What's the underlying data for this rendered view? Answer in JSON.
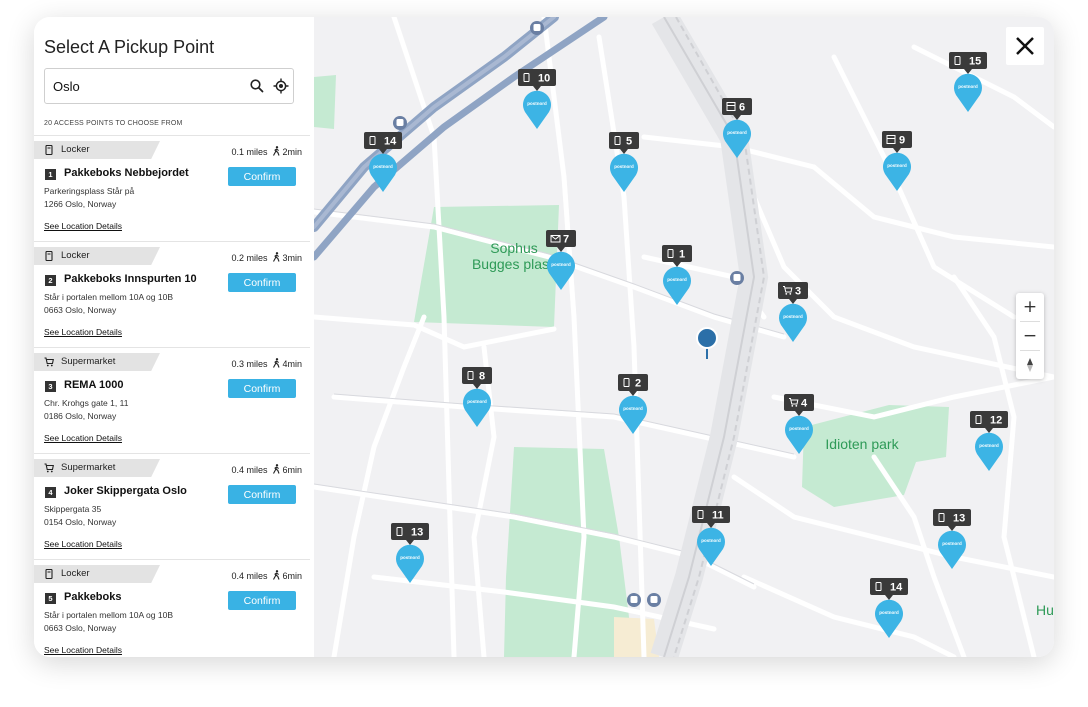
{
  "panel": {
    "title": "Select A Pickup Point",
    "search_value": "Oslo",
    "count_text": "20 ACCESS POINTS TO CHOOSE FROM"
  },
  "items": [
    {
      "category": "Locker",
      "icon": "locker-icon",
      "distance": "0.1 miles",
      "walk": "2min",
      "number": "1",
      "name": "Pakkeboks Nebbejordet",
      "address1": "Parkeringsplass Står på",
      "address2": "1266 Oslo, Norway",
      "confirm": "Confirm",
      "details": "See Location Details"
    },
    {
      "category": "Locker",
      "icon": "locker-icon",
      "distance": "0.2 miles",
      "walk": "3min",
      "number": "2",
      "name": "Pakkeboks Innspurten 10",
      "address1": "Står i portalen mellom 10A og 10B",
      "address2": "0663 Oslo, Norway",
      "confirm": "Confirm",
      "details": "See Location Details"
    },
    {
      "category": "Supermarket",
      "icon": "cart-icon",
      "distance": "0.3 miles",
      "walk": "4min",
      "number": "3",
      "name": "REMA 1000",
      "address1": "Chr. Krohgs gate 1, 11",
      "address2": "0186 Oslo, Norway",
      "confirm": "Confirm",
      "details": "See Location Details"
    },
    {
      "category": "Supermarket",
      "icon": "cart-icon",
      "distance": "0.4 miles",
      "walk": "6min",
      "number": "4",
      "name": "Joker Skippergata Oslo",
      "address1": "Skippergata 35",
      "address2": "0154 Oslo, Norway",
      "confirm": "Confirm",
      "details": "See Location Details"
    },
    {
      "category": "Locker",
      "icon": "locker-icon",
      "distance": "0.4 miles",
      "walk": "6min",
      "number": "5",
      "name": "Pakkeboks",
      "address1": "Står i portalen mellom 10A og 10B",
      "address2": "0663 Oslo, Norway",
      "confirm": "Confirm",
      "details": "See Location Details"
    }
  ],
  "map": {
    "park_labels": [
      "Sophus",
      "Bugges plass",
      "Idioten park",
      "Hu"
    ],
    "pin_brand": "postnord",
    "pin_color": "#3cb4e5",
    "markers": [
      {
        "n": "10",
        "icon": "locker-icon"
      },
      {
        "n": "15",
        "icon": "locker-icon"
      },
      {
        "n": "6",
        "icon": "store-icon"
      },
      {
        "n": "5",
        "icon": "locker-icon"
      },
      {
        "n": "14",
        "icon": "locker-icon"
      },
      {
        "n": "9",
        "icon": "store-icon"
      },
      {
        "n": "7",
        "icon": "mail-icon"
      },
      {
        "n": "1",
        "icon": "locker-icon"
      },
      {
        "n": "3",
        "icon": "cart-icon"
      },
      {
        "n": "8",
        "icon": "locker-icon"
      },
      {
        "n": "2",
        "icon": "locker-icon"
      },
      {
        "n": "4",
        "icon": "cart-icon"
      },
      {
        "n": "12",
        "icon": "locker-icon"
      },
      {
        "n": "11",
        "icon": "locker-icon"
      },
      {
        "n": "13",
        "icon": "locker-icon"
      },
      {
        "n": "13",
        "icon": "locker-icon"
      },
      {
        "n": "14",
        "icon": "locker-icon"
      }
    ],
    "zoom_in": "+",
    "zoom_out": "−"
  },
  "colors": {
    "accent": "#39b2e4",
    "tag": "#3a3a3a",
    "park": "#c5ead2",
    "park_text": "#2e9a57",
    "road_major": "#8fa4c4"
  }
}
